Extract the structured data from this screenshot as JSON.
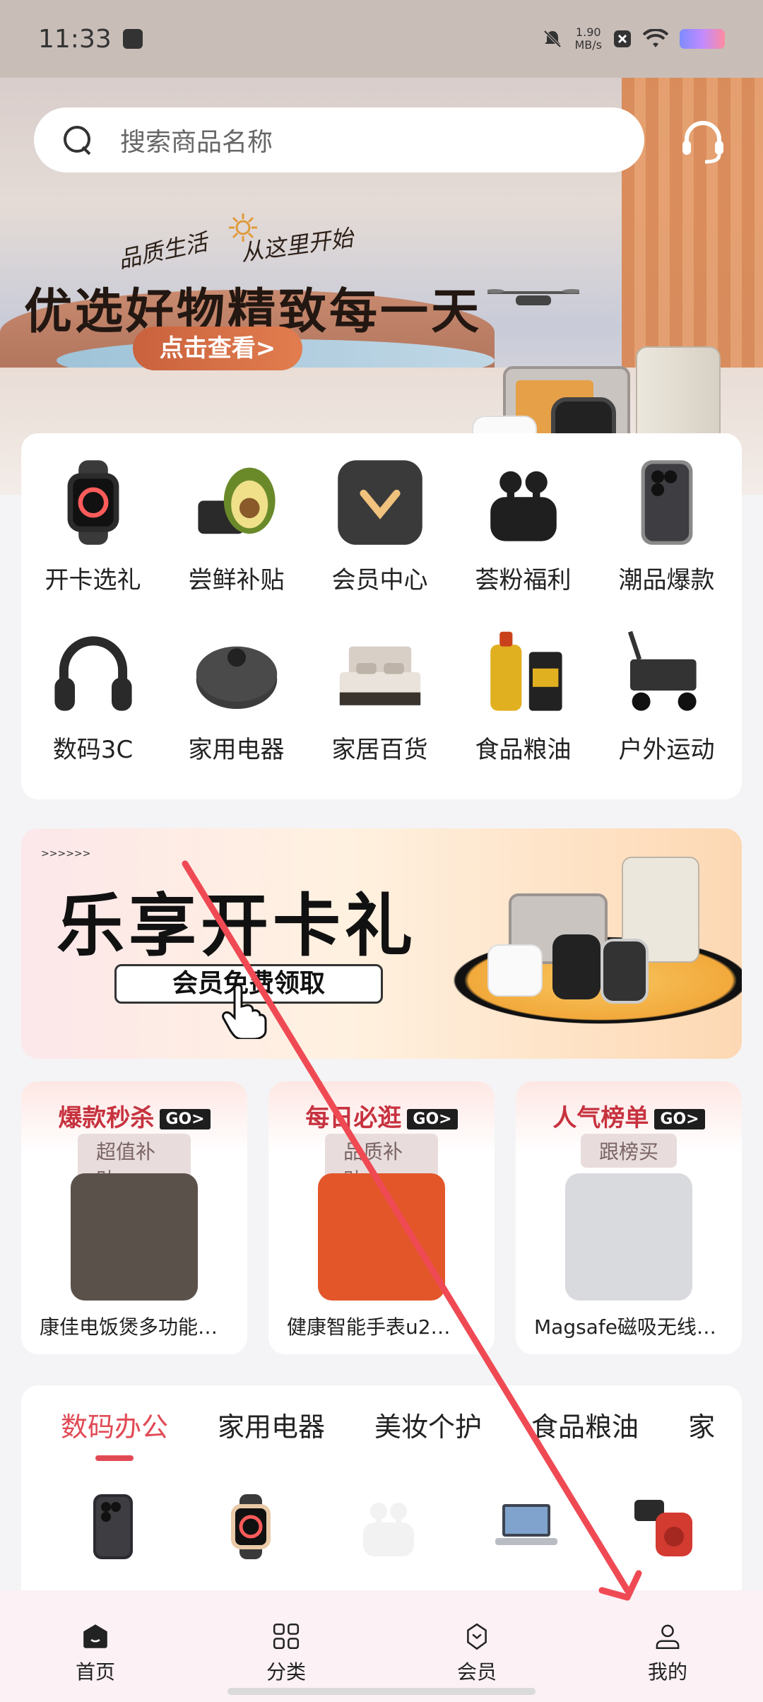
{
  "status_bar": {
    "time": "11:33",
    "speed_value": "1.90",
    "speed_unit": "MB/s"
  },
  "search": {
    "placeholder": "搜索商品名称"
  },
  "hero": {
    "tag_left": "品质生活",
    "tag_right": "从这里开始",
    "title": "优选好物精致每一天",
    "button": "点击查看>"
  },
  "categories": [
    {
      "label": "开卡选礼",
      "icon": "smartwatch-icon",
      "color": "#2b2b2b"
    },
    {
      "label": "尝鲜补贴",
      "icon": "avocado-icon",
      "color": "#6a8a2a"
    },
    {
      "label": "会员中心",
      "icon": "member-bag-icon",
      "color": "#3a3a3a"
    },
    {
      "label": "荟粉福利",
      "icon": "earbuds-icon",
      "color": "#1f1f1f"
    },
    {
      "label": "潮品爆款",
      "icon": "phone-icon",
      "color": "#8a8a8a"
    },
    {
      "label": "数码3C",
      "icon": "headphones-icon",
      "color": "#2a2a2a"
    },
    {
      "label": "家用电器",
      "icon": "robot-vacuum-icon",
      "color": "#3c3c3c"
    },
    {
      "label": "家居百货",
      "icon": "bed-icon",
      "color": "#9a8f86"
    },
    {
      "label": "食品粮油",
      "icon": "cooking-oil-icon",
      "color": "#e1b021"
    },
    {
      "label": "户外运动",
      "icon": "wagon-icon",
      "color": "#333333"
    }
  ],
  "member_banner": {
    "title": "乐享开卡礼",
    "subtitle": "会员免费领取",
    "dots": ">>>>>>"
  },
  "promos": [
    {
      "title": "爆款秒杀",
      "go": "GO>",
      "tag": "超值补贴",
      "name": "康佳电饭煲多功能…",
      "img_color": "#5b514b"
    },
    {
      "title": "每日必逛",
      "go": "GO>",
      "tag": "品质补贴",
      "name": "健康智能手表u2…",
      "img_color": "#e2562a"
    },
    {
      "title": "人气榜单",
      "go": "GO>",
      "tag": "跟榜买",
      "name": "Magsafe磁吸无线充…",
      "img_color": "#d9dadd"
    }
  ],
  "tabs": [
    {
      "label": "数码办公",
      "active": true
    },
    {
      "label": "家用电器",
      "active": false
    },
    {
      "label": "美妆个护",
      "active": false
    },
    {
      "label": "食品粮油",
      "active": false
    },
    {
      "label": "家",
      "active": false
    }
  ],
  "tab_products": [
    {
      "icon": "phone-icon",
      "color": "#2b2c31"
    },
    {
      "icon": "smartwatch-icon",
      "color": "#e9c9a7"
    },
    {
      "icon": "earbuds-icon",
      "color": "#f2f2f2"
    },
    {
      "icon": "laptop-icon",
      "color": "#b9bcc3"
    },
    {
      "icon": "speaker-icon",
      "color": "#d33a30"
    }
  ],
  "bottom_nav": [
    {
      "label": "首页",
      "icon": "home-icon"
    },
    {
      "label": "分类",
      "icon": "category-icon"
    },
    {
      "label": "会员",
      "icon": "member-icon"
    },
    {
      "label": "我的",
      "icon": "profile-icon"
    }
  ]
}
